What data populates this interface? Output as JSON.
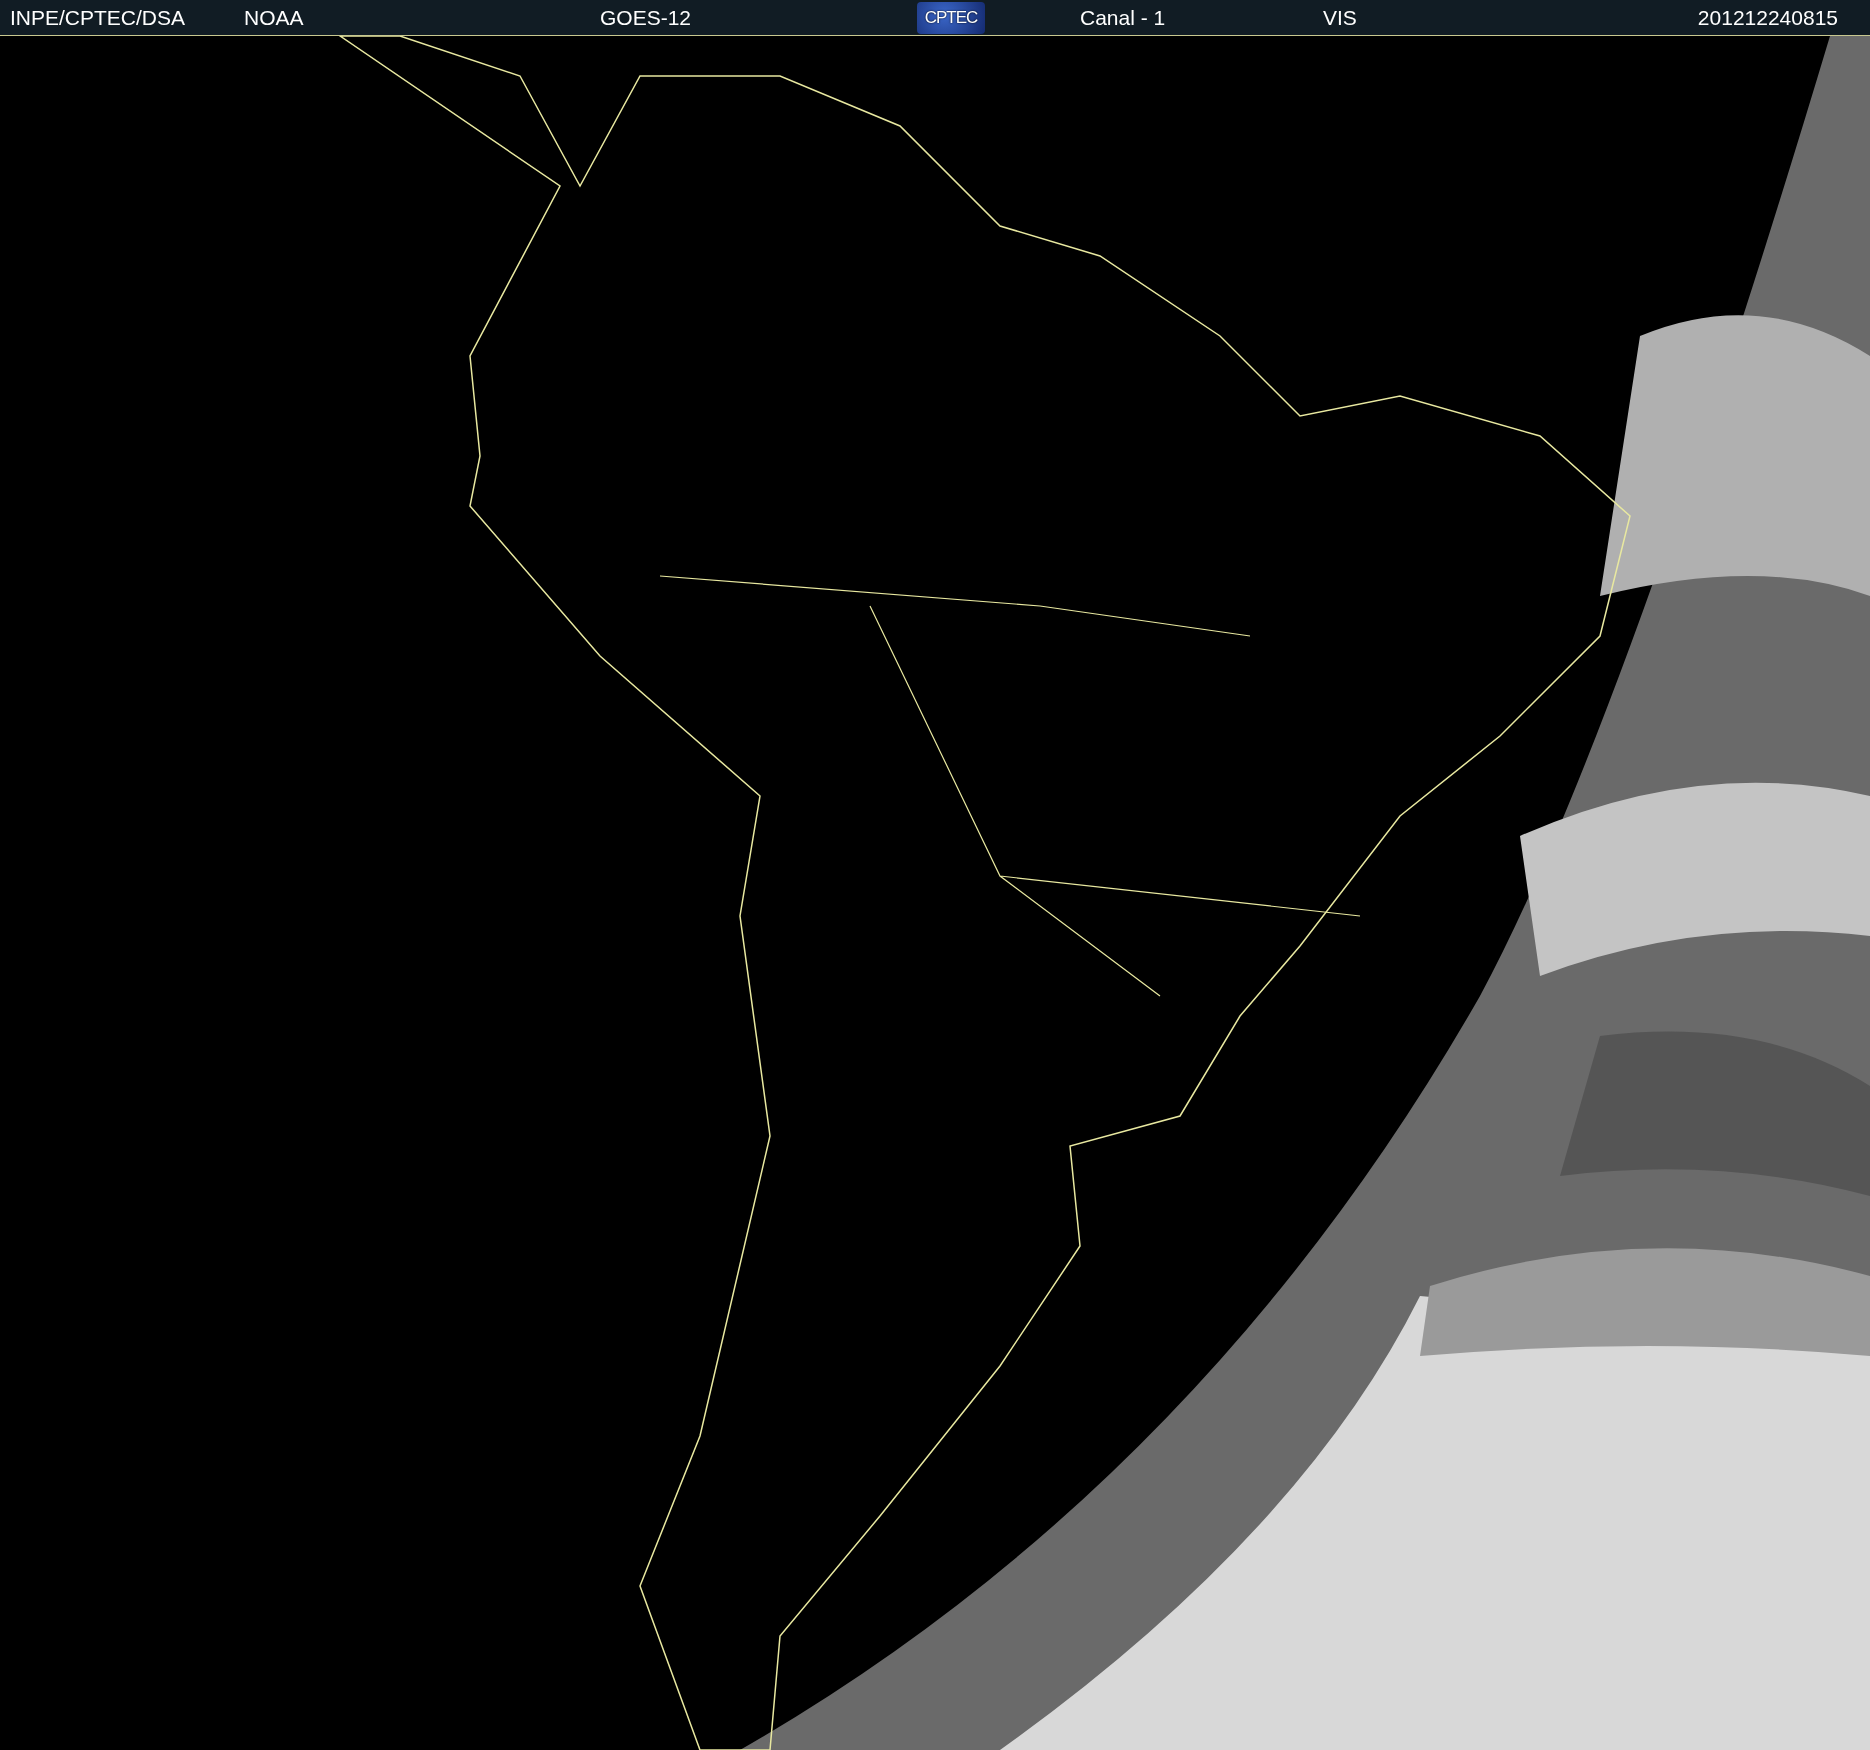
{
  "header": {
    "source": "INPE/CPTEC/DSA",
    "agency": "NOAA",
    "satellite": "GOES-12",
    "logo": "CPTEC",
    "channel": "Canal - 1",
    "band": "VIS",
    "timestamp": "201212240815"
  }
}
